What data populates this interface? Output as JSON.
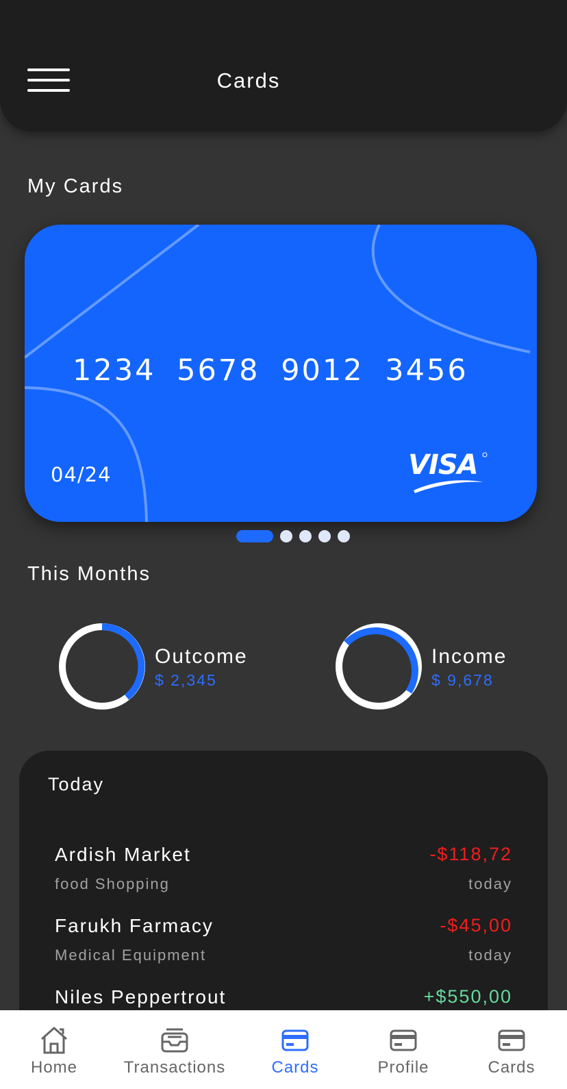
{
  "header": {
    "title": "Cards",
    "menu_icon": "hamburger-menu-icon"
  },
  "my_cards": {
    "title": "My Cards",
    "card": {
      "number": "1234 5678 9012 3456",
      "expiry": "04/24",
      "brand": "VISA",
      "color": "#1365fe"
    },
    "pagination": {
      "count": 5,
      "active_index": 0
    }
  },
  "this_months": {
    "title": "This Months",
    "outcome": {
      "label": "Outcome",
      "value": "$ 2,345"
    },
    "income": {
      "label": "Income",
      "value": "$ 9,678"
    }
  },
  "today": {
    "title": "Today",
    "transactions": [
      {
        "name": "Ardish Market",
        "category": "food Shopping",
        "amount": "-$118,72",
        "time": "today",
        "type": "negative"
      },
      {
        "name": "Farukh Farmacy",
        "category": "Medical Equipment",
        "amount": "-$45,00",
        "time": "today",
        "type": "negative"
      },
      {
        "name": "Niles Peppertrout",
        "category": "",
        "amount": "+$550,00",
        "time": "",
        "type": "positive"
      }
    ]
  },
  "bottom_nav": {
    "items": [
      {
        "label": "Home",
        "icon": "home-icon"
      },
      {
        "label": "Transactions",
        "icon": "inbox-icon"
      },
      {
        "label": "Cards",
        "icon": "credit-card-icon",
        "active": true
      },
      {
        "label": "Profile",
        "icon": "credit-card-icon"
      },
      {
        "label": "Cards",
        "icon": "credit-card-icon"
      }
    ]
  },
  "colors": {
    "accent": "#1d6afe",
    "negative": "#f21d1d",
    "positive": "#66d99d",
    "background": "#343434",
    "panel": "#1e1e1e"
  }
}
